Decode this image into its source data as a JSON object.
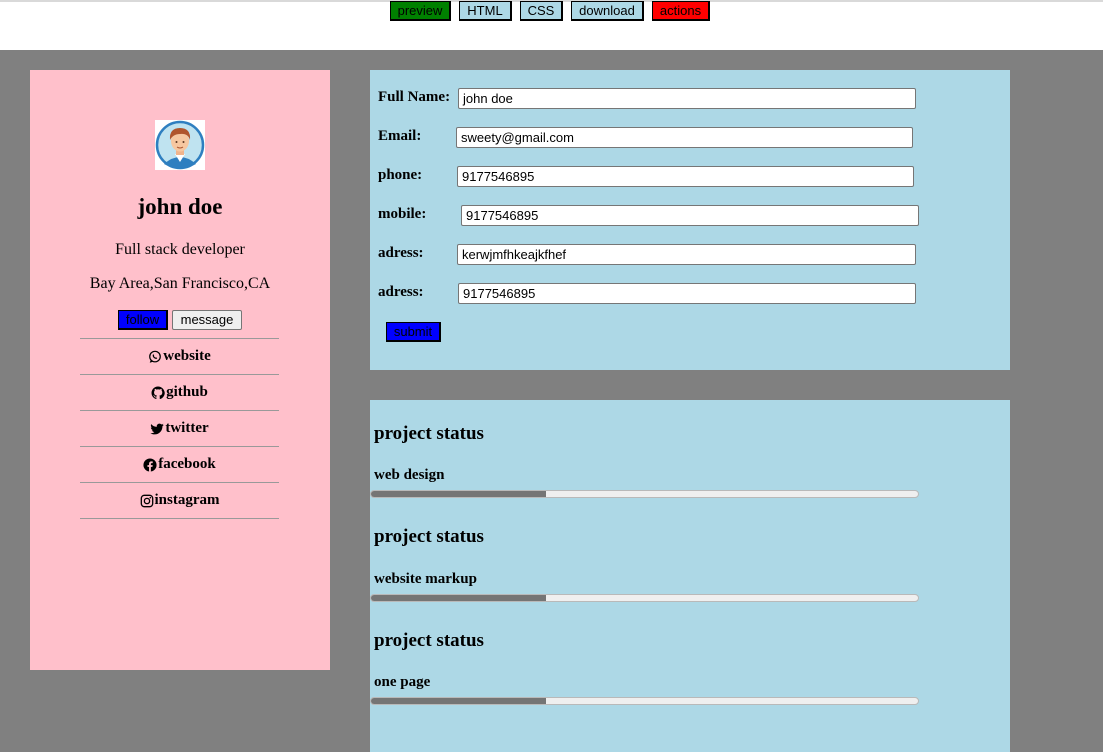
{
  "toolbar": {
    "buttons": [
      {
        "label": "preview",
        "color": "#008000"
      },
      {
        "label": "HTML",
        "color": "#add8e6"
      },
      {
        "label": "CSS",
        "color": "#add8e6"
      },
      {
        "label": "download",
        "color": "#add8e6"
      },
      {
        "label": "actions",
        "color": "#ff0000"
      }
    ]
  },
  "colors": {
    "page_background": "#808080",
    "sidebar_background": "#ffc0cb",
    "panel_background": "#add8e6",
    "follow_button": "#0000ff",
    "submit_button": "#0000ff"
  },
  "profile": {
    "avatar_icon": "male-avatar-icon",
    "name": "john doe",
    "title": "Full stack developer",
    "location": "Bay Area,San Francisco,CA",
    "follow_label": "follow",
    "message_label": "message",
    "links": [
      {
        "label": "website",
        "icon": "whatsapp-icon"
      },
      {
        "label": "github",
        "icon": "github-icon"
      },
      {
        "label": "twitter",
        "icon": "twitter-icon"
      },
      {
        "label": "facebook",
        "icon": "facebook-icon"
      },
      {
        "label": "instagram",
        "icon": "instagram-icon"
      }
    ]
  },
  "form": {
    "fields": [
      {
        "label": "Full Name:",
        "value": "john doe"
      },
      {
        "label": "Email:",
        "value": "sweety@gmail.com"
      },
      {
        "label": "phone:",
        "value": "9177546895"
      },
      {
        "label": "mobile:",
        "value": "9177546895"
      },
      {
        "label": "adress:",
        "value": "kerwjmfhkeajkfhef"
      },
      {
        "label": "adress:",
        "value": "9177546895"
      }
    ],
    "submit_label": "submit"
  },
  "status": {
    "sections": [
      {
        "heading": "project status",
        "label": "web design",
        "progress": 0.32
      },
      {
        "heading": "project status",
        "label": "website markup",
        "progress": 0.32
      },
      {
        "heading": "project status",
        "label": "one page",
        "progress": 0.32
      }
    ]
  }
}
